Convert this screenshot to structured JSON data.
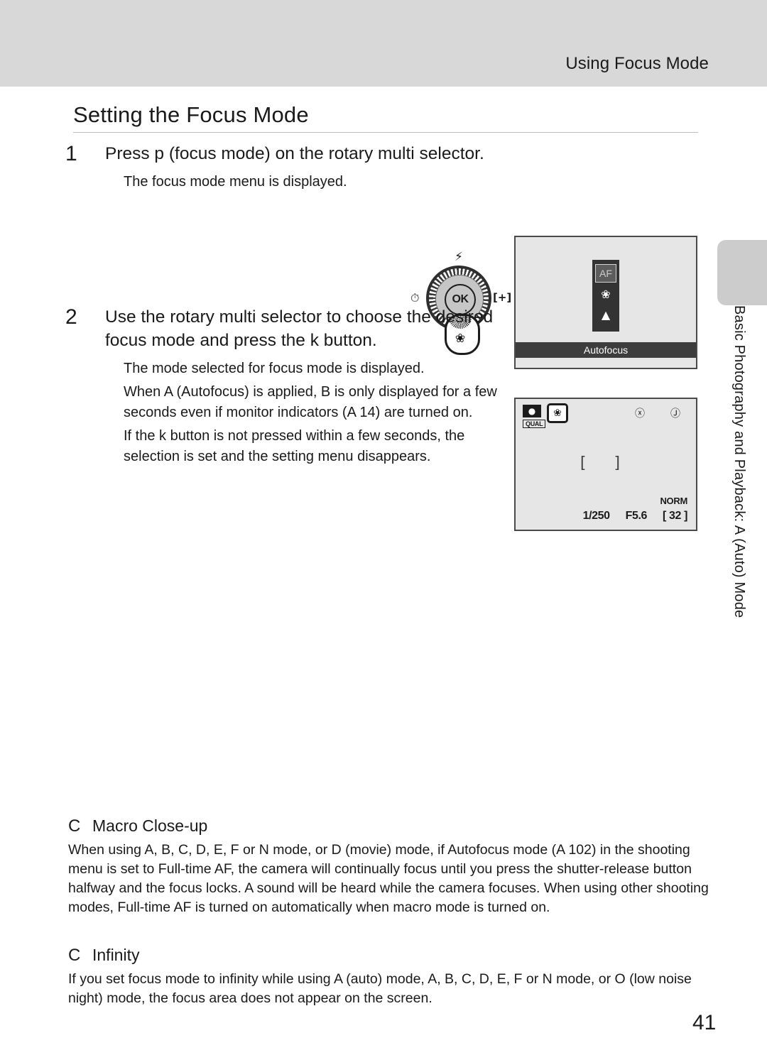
{
  "header": {
    "running_head": "Using Focus Mode"
  },
  "section": {
    "title": "Setting the Focus Mode"
  },
  "steps": [
    {
      "number": "1",
      "heading_parts": [
        "Press ",
        "p",
        " (focus mode) on the rotary multi selector."
      ],
      "heading_plain": "Press p (focus mode) on the rotary multi selector.",
      "bullets": [
        "The focus mode menu is displayed."
      ]
    },
    {
      "number": "2",
      "heading_plain": "Use the rotary multi selector to choose the desired focus mode and press the k button.",
      "bullets": [
        "The mode selected for focus mode is displayed.",
        "When A (Autofocus) is applied, B is only displayed for a few seconds even if monitor indicators (A 14) are turned on.",
        "If the k button is not pressed within a few seconds, the selection is set and the setting menu disappears."
      ]
    }
  ],
  "rotary": {
    "ok_label": "OK",
    "flash_icon": "⚡",
    "timer_icon": "⏱",
    "focus_area_icon": "[+]",
    "macro_icon": "❀"
  },
  "lcd_focus_menu": {
    "items": [
      {
        "name": "autofocus",
        "label": "AF",
        "selected": true
      },
      {
        "name": "macro",
        "label": "❀",
        "selected": false
      },
      {
        "name": "infinity",
        "label": "▲",
        "selected": false
      }
    ],
    "caption": "Autofocus"
  },
  "lcd_shooting": {
    "camera_icon": "●",
    "quality_badge": "QUAL",
    "macro_icon": "❀",
    "icon_a": "ⓧ",
    "icon_b": "Ⓙ",
    "focus_brackets": "[ ]",
    "image_size": "NORM",
    "shutter_speed": "1/250",
    "aperture": "F5.6",
    "shots_remaining": "[ 32 ]"
  },
  "notes": [
    {
      "glyph": "C",
      "title": "Macro Close-up",
      "body": "When using A, B, C, D, E, F or N mode, or D (movie) mode, if Autofocus mode (A 102) in the shooting menu is set to Full-time AF, the camera will continually focus until you press the shutter-release button halfway and the focus locks. A sound will be heard while the camera focuses. When using other shooting modes, Full-time AF is turned on automatically when macro mode is turned on."
    },
    {
      "glyph": "C",
      "title": "Infinity",
      "body": "If you set focus mode to infinity while using A (auto) mode, A, B, C, D, E, F or N mode, or O (low noise night) mode, the focus area does not appear on the screen."
    }
  ],
  "edge": {
    "chapter_label": "Basic Photography and Playback: A (Auto) Mode"
  },
  "footer": {
    "page_number": "41"
  }
}
